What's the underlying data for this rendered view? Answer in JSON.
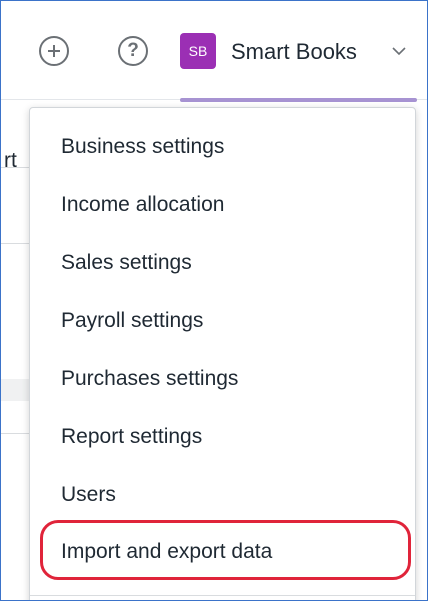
{
  "header": {
    "add_icon_glyph": "+",
    "help_icon_glyph": "?",
    "avatar_initials": "SB",
    "avatar_color": "#9b2fb4",
    "business_name": "Smart Books",
    "chevron_icon": "chevron-down-icon",
    "active_underline_color": "#a793d2"
  },
  "background": {
    "partial_text": "rt"
  },
  "settings_menu": {
    "items": [
      {
        "label": "Business settings"
      },
      {
        "label": "Income allocation"
      },
      {
        "label": "Sales settings"
      },
      {
        "label": "Payroll settings"
      },
      {
        "label": "Purchases settings"
      },
      {
        "label": "Report settings"
      },
      {
        "label": "Users"
      },
      {
        "label": "Import and export data"
      }
    ],
    "highlighted_item": "Import and export data",
    "highlight_color": "#e0243a"
  }
}
